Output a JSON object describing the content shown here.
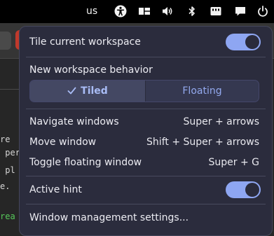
{
  "topbar": {
    "keyboard_layout": "us",
    "icons": [
      "accessibility-icon",
      "workspace-tiling-icon",
      "volume-icon",
      "bluetooth-icon",
      "network-icon",
      "notifications-icon",
      "power-icon"
    ]
  },
  "background_window": {
    "code_lines": [
      "re",
      " per",
      " pl",
      "e.",
      "rea"
    ]
  },
  "menu": {
    "tile_workspace": {
      "label": "Tile current workspace",
      "enabled": true
    },
    "new_workspace_behavior": {
      "heading": "New workspace behavior",
      "options": [
        "Tiled",
        "Floating"
      ],
      "selected": "Tiled"
    },
    "shortcuts": [
      {
        "label": "Navigate windows",
        "keys": "Super + arrows"
      },
      {
        "label": "Move window",
        "keys": "Shift + Super + arrows"
      },
      {
        "label": "Toggle floating window",
        "keys": "Super + G"
      }
    ],
    "active_hint": {
      "label": "Active hint",
      "enabled": true
    },
    "settings_link": "Window management settings..."
  },
  "colors": {
    "menu_bg": "#2b2c3d",
    "accent": "#8ea6f2",
    "selected_segment": "#444863"
  }
}
